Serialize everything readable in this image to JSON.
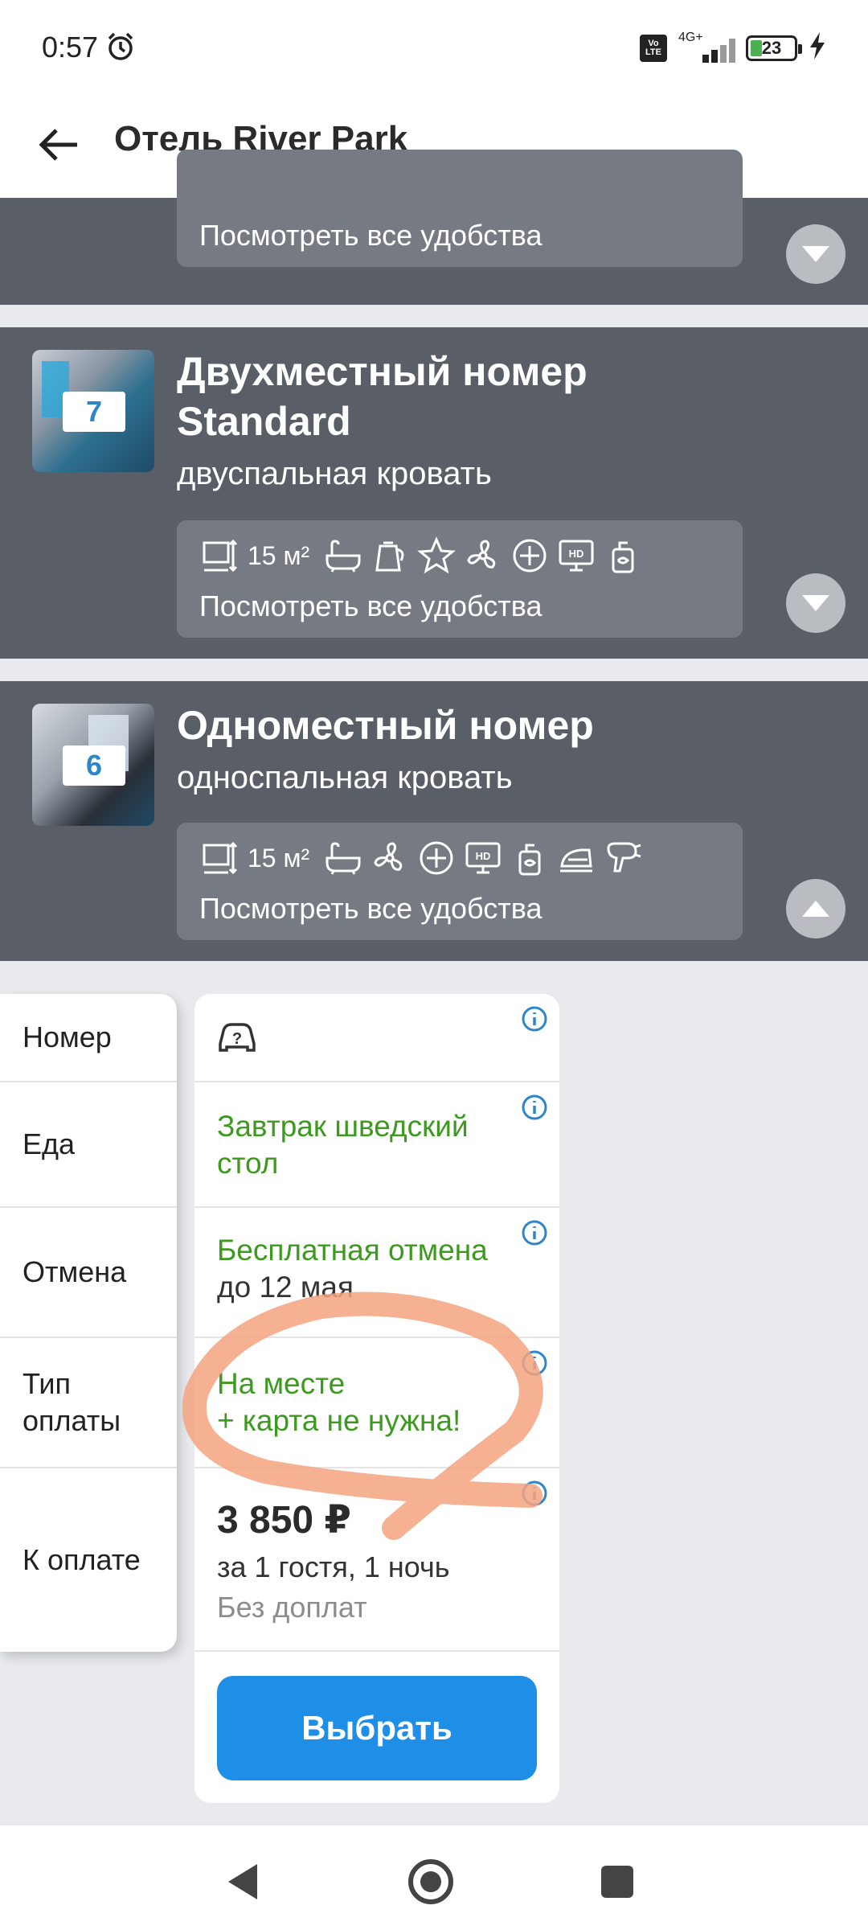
{
  "status_bar": {
    "time": "0:57",
    "network": "4G+",
    "battery": "23",
    "volte": [
      "Vo",
      "LTE"
    ]
  },
  "app_bar": {
    "title": "Отель River Park"
  },
  "rooms": [
    {
      "amenities_link": "Посмотреть все удобства",
      "expanded": false
    },
    {
      "photo_count": "7",
      "title_line1": "Двухместный номер",
      "title_line2": "Standard",
      "bed": "двуспальная кровать",
      "area": "15 м²",
      "amenities": [
        "bathtub-icon",
        "kettle-icon",
        "star-icon",
        "fan-icon",
        "plus-icon",
        "tv-icon",
        "soap-icon"
      ],
      "amenities_link": "Посмотреть все удобства",
      "expanded": false
    },
    {
      "photo_count": "6",
      "title": "Одноместный номер",
      "bed": "односпальная кровать",
      "area": "15 м²",
      "amenities": [
        "bathtub-icon",
        "fan-icon",
        "plus-icon",
        "tv-icon",
        "soap-icon",
        "iron-icon",
        "hairdryer-icon"
      ],
      "amenities_link": "Посмотреть все удобства",
      "expanded": true
    }
  ],
  "labels": {
    "room": "Номер",
    "food": "Еда",
    "cancel": "Отмена",
    "payment_type_1": "Тип",
    "payment_type_2": "оплаты",
    "to_pay": "К оплате"
  },
  "offer": {
    "room_icon": "car-question-icon",
    "food_1": "Завтрак шведский",
    "food_2": "стол",
    "cancel_1": "Бесплатная отмена",
    "cancel_2": "до 12 мая",
    "payment_1": "На месте",
    "payment_2": "+ карта не нужна!",
    "price": "3 850 ₽",
    "price_note": "за 1 гостя, 1 ночь",
    "extra": "Без доплат",
    "choose_label": "Выбрать"
  },
  "colors": {
    "card_bg": "#5a5f67",
    "green_text": "#3c9a1f",
    "primary_button": "#1f8ee6",
    "annotation": "#f4a27f",
    "info_icon": "#2f86c6"
  }
}
